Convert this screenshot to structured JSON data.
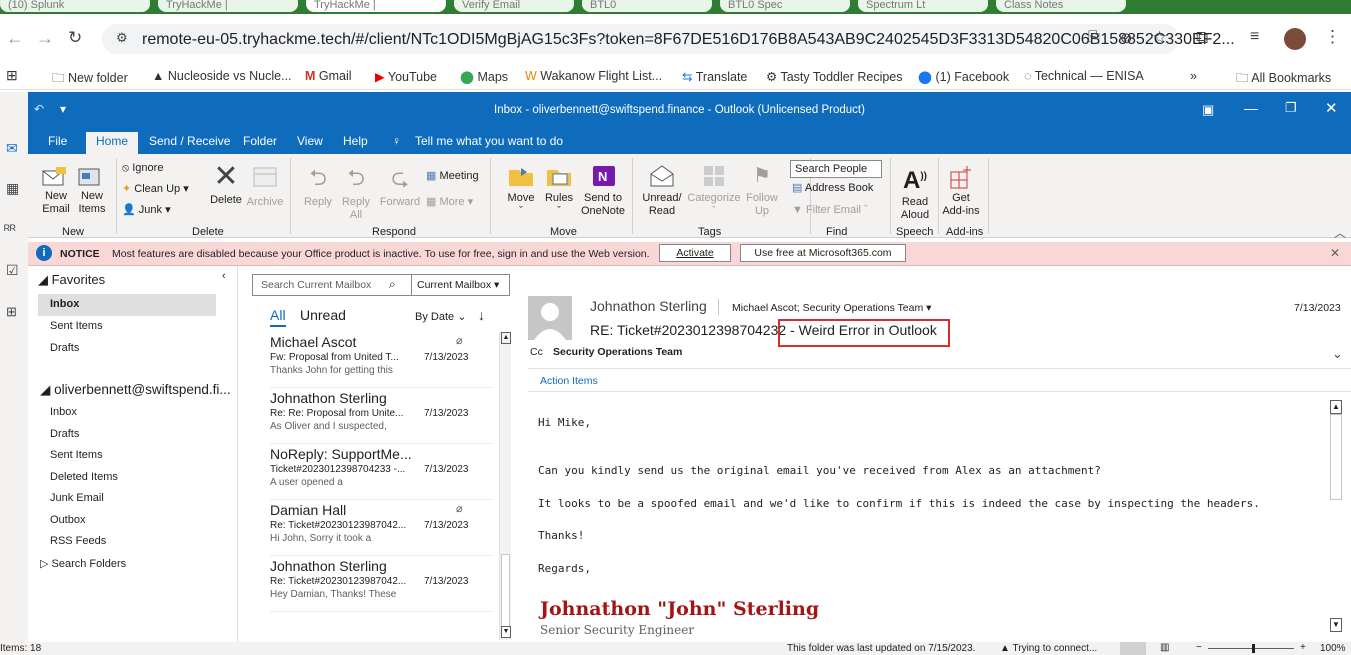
{
  "browser": {
    "tabs": [
      "(10) Splunk",
      "TryHackMe |",
      "TryHackMe |",
      "Verify Email",
      "BTL0",
      "BTL0 Spec",
      "Spectrum Lt",
      "Class Notes"
    ],
    "url": "remote-eu-05.tryhackme.tech/#/client/NTc1ODI5MgBjAG15c3Fs?token=8F67DE516D176B8A543AB9C2402545D3F3313D54820C06B158852C330EF2...",
    "bookmarks": [
      "New folder",
      "Nucleoside vs Nucle...",
      "Gmail",
      "YouTube",
      "Maps",
      "Wakanow Flight List...",
      "Translate",
      "Tasty Toddler Recipes",
      "(1) Facebook",
      "Technical — ENISA",
      "All Bookmarks"
    ]
  },
  "outlook": {
    "window_title": "Inbox - oliverbennett@swiftspend.finance  -  Outlook (Unlicensed Product)",
    "menu_tabs": [
      "File",
      "Home",
      "Send / Receive",
      "Folder",
      "View",
      "Help"
    ],
    "tell_me": "Tell me what you want to do",
    "ribbon": {
      "new_email": "New\nEmail",
      "new_items": "New\nItems",
      "ignore": "Ignore",
      "clean_up": "Clean Up",
      "junk": "Junk",
      "delete": "Delete",
      "archive": "Archive",
      "reply": "Reply",
      "reply_all": "Reply\nAll",
      "forward": "Forward",
      "meeting": "Meeting",
      "more": "More",
      "move": "Move",
      "rules": "Rules",
      "send_to_onenote": "Send to\nOneNote",
      "unread_read": "Unread/\nRead",
      "categorize": "Categorize",
      "follow_up": "Follow\nUp",
      "search_people": "Search People",
      "address_book": "Address Book",
      "filter_email": "Filter Email",
      "read_aloud": "Read\nAloud",
      "get_addins": "Get\nAdd-ins",
      "groups": [
        "New",
        "Delete",
        "Respond",
        "Move",
        "Tags",
        "Find",
        "Speech",
        "Add-ins"
      ]
    },
    "notice": {
      "label": "NOTICE",
      "text": "Most features are disabled because your Office product is inactive. To use for free, sign in and use the Web version.",
      "activate": "Activate",
      "use_free": "Use free at Microsoft365.com"
    },
    "favorites_header": "Favorites",
    "favorites": [
      "Inbox",
      "Sent Items",
      "Drafts"
    ],
    "account": "oliverbennett@swiftspend.fi...",
    "account_folders": [
      "Inbox",
      "Drafts",
      "Sent Items",
      "Deleted Items",
      "Junk Email",
      "Outbox",
      "RSS Feeds",
      "Search Folders"
    ],
    "search": {
      "placeholder": "Search Current Mailbox",
      "scope": "Current Mailbox"
    },
    "filters": {
      "all": "All",
      "unread": "Unread",
      "sort": "By Date"
    },
    "messages": [
      {
        "sender": "Michael Ascot",
        "subject": "Fw: Proposal from United T...",
        "date": "7/13/2023",
        "preview": "Thanks John for getting this",
        "attachment": true
      },
      {
        "sender": "Johnathon Sterling",
        "subject": "Re: Re: Proposal from Unite...",
        "date": "7/13/2023",
        "preview": "As Oliver and I suspected,",
        "attachment": false
      },
      {
        "sender": "NoReply: SupportMe...",
        "subject": "Ticket#2023012398704233 -...",
        "date": "7/13/2023",
        "preview": "A user opened a",
        "attachment": false
      },
      {
        "sender": "Damian Hall",
        "subject": "Re: Ticket#20230123987042...",
        "date": "7/13/2023",
        "preview": "Hi John,  Sorry it took a",
        "attachment": true
      },
      {
        "sender": "Johnathon Sterling",
        "subject": "Re: Ticket#20230123987042...",
        "date": "7/13/2023",
        "preview": "Hey Damian,  Thanks! These",
        "attachment": false
      }
    ],
    "reading": {
      "from": "Johnathon Sterling",
      "to": "Michael Ascot; Security Operations Team",
      "subject_prefix": "RE: Ticket#2023012398704232 -",
      "subject_highlight": "Weird Error in Outlook",
      "date": "7/13/2023",
      "cc_label": "Cc",
      "cc": "Security Operations Team",
      "action_items": "Action Items",
      "body": [
        "Hi Mike,",
        "Can you kindly send us the original email you've received from Alex as an attachment?",
        "It looks to be a spoofed email and we'd like to confirm if this is indeed the case by inspecting the headers.",
        "Thanks!",
        "Regards,"
      ],
      "sig_name": "Johnathon \"John\" Sterling",
      "sig_title": "Senior Security Engineer"
    },
    "status": {
      "items": "Items: 18",
      "updated": "This folder was last updated on 7/15/2023.",
      "connecting": "Trying to connect...",
      "zoom": "100%"
    }
  }
}
